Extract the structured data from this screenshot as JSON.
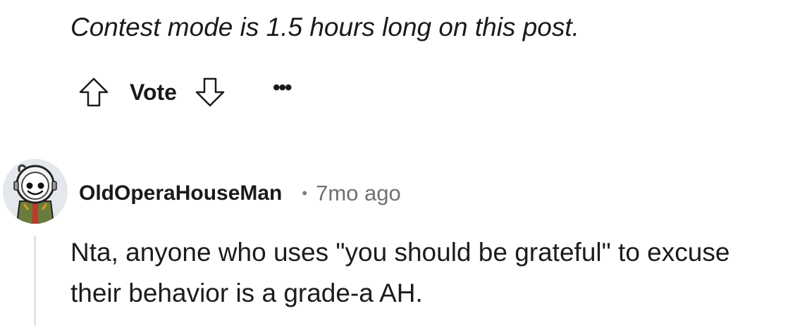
{
  "post": {
    "contest_note": "Contest mode is 1.5 hours long on this post."
  },
  "vote_bar": {
    "label": "Vote",
    "upvote_icon": "arrow-up-outline-icon",
    "downvote_icon": "arrow-down-outline-icon",
    "more_label": "•••"
  },
  "comment": {
    "author": "OldOperaHouseMan",
    "separator": "•",
    "timestamp": "7mo ago",
    "body": "Nta, anyone who uses \"you should be grateful\" to excuse their behavior is a grade-a AH.",
    "avatar_icon": "snoo-astronaut-avatar"
  },
  "colors": {
    "text": "#1a1a1b",
    "meta": "#6f7173",
    "thread_line": "#e0e2e5",
    "avatar_bg": "#e4e8ec"
  }
}
